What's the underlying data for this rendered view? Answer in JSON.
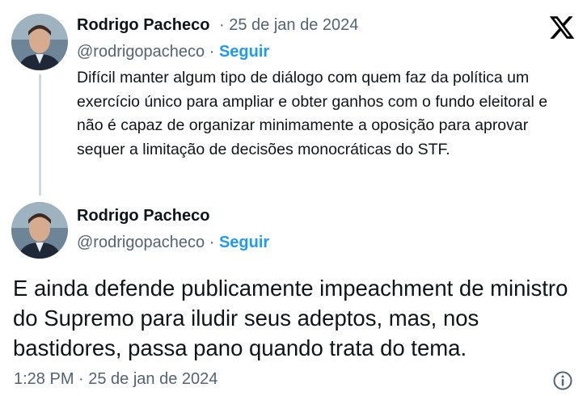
{
  "reply_tweet": {
    "author_name": "Rodrigo Pacheco",
    "separator": " · ",
    "date": "25 de jan de 2024",
    "handle": "@rodrigopacheco",
    "follow_label": "Seguir",
    "text": "Difícil manter algum tipo de diálogo com quem faz da política um exercício único para ampliar e obter ganhos com o fundo eleitoral e não é capaz de organizar minimamente a oposição para aprovar sequer a limitação de decisões monocráticas do STF."
  },
  "main_tweet": {
    "author_name": "Rodrigo Pacheco",
    "handle": "@rodrigopacheco",
    "separator": " · ",
    "follow_label": "Seguir",
    "text": "E ainda defende publicamente impeachment de ministro do Supremo para iludir seus adeptos, mas, nos bastidores, passa pano quando trata do tema.",
    "timestamp": "1:28 PM · 25 de jan de 2024"
  },
  "icons": {
    "platform_logo": "x-logo-icon",
    "info": "info-icon"
  },
  "colors": {
    "text_primary": "#0f1419",
    "text_secondary": "#536471",
    "link_blue": "#1d9bf0",
    "thread_line": "#cfd9de"
  }
}
